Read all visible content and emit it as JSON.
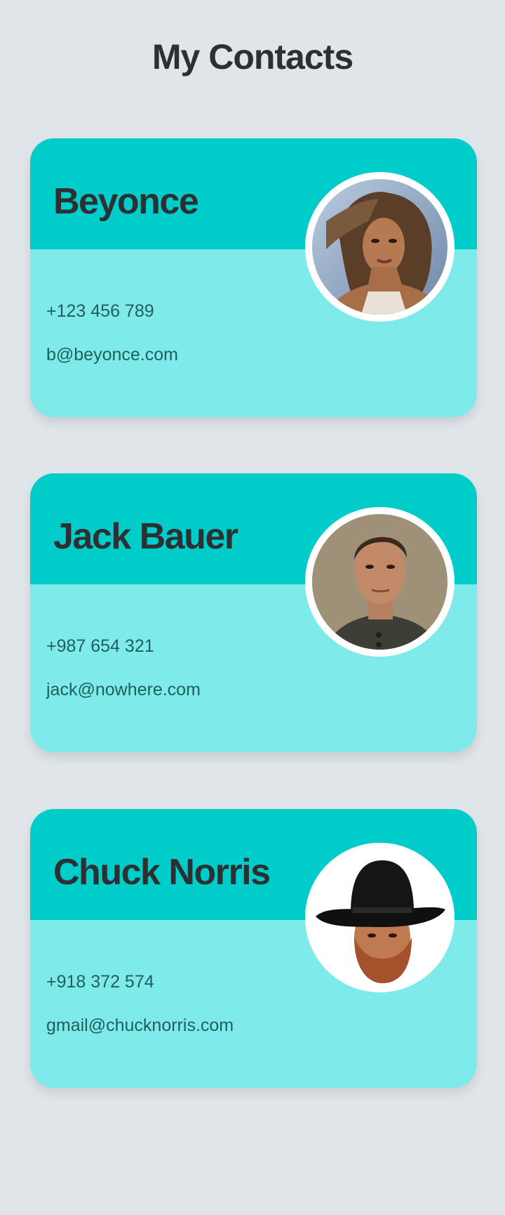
{
  "page": {
    "title": "My Contacts",
    "background": "#dfe5e9"
  },
  "theme": {
    "header_color": "#00cdc9",
    "body_color": "#7eeaea",
    "text_dark": "#2c3033",
    "text_info": "#1f5f5e"
  },
  "contacts": [
    {
      "name": "Beyonce",
      "phone": "+123 456 789",
      "email": "b@beyonce.com",
      "avatar_icon": "portrait-beyonce"
    },
    {
      "name": "Jack Bauer",
      "phone": "+987 654 321",
      "email": "jack@nowhere.com",
      "avatar_icon": "portrait-jack-bauer"
    },
    {
      "name": "Chuck Norris",
      "phone": "+918 372 574",
      "email": "gmail@chucknorris.com",
      "avatar_icon": "portrait-chuck-norris"
    }
  ]
}
